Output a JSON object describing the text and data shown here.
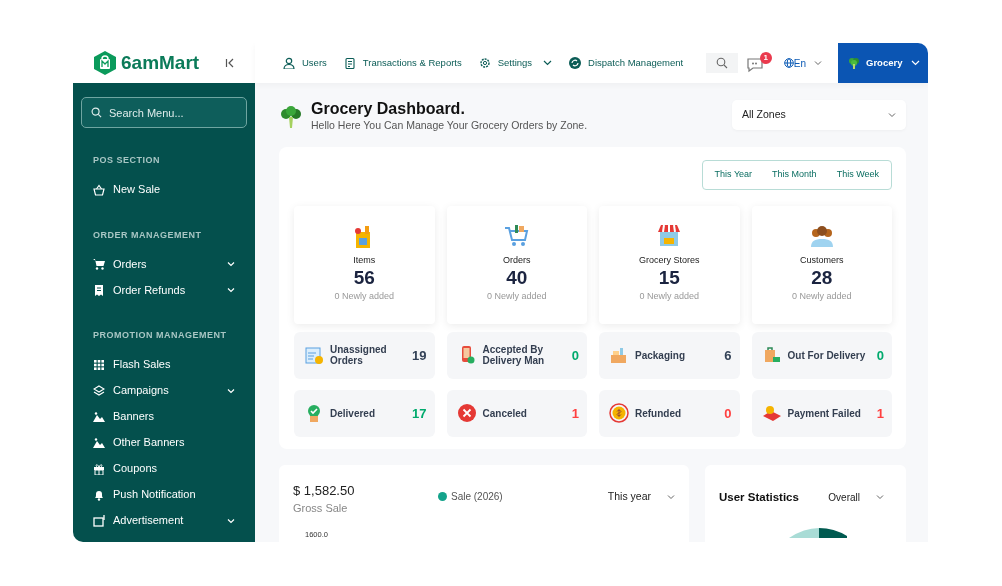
{
  "brand": {
    "name": "6amMart"
  },
  "topnav": [
    {
      "label": "Users",
      "dropdown": false
    },
    {
      "label": "Transactions & Reports",
      "dropdown": false
    },
    {
      "label": "Settings",
      "dropdown": true
    },
    {
      "label": "Dispatch Management",
      "dropdown": false
    }
  ],
  "notifications": {
    "count": "1"
  },
  "language": {
    "label": "En"
  },
  "module": {
    "label": "Grocery"
  },
  "sidebar": {
    "search": {
      "placeholder": "Search Menu..."
    },
    "sections": [
      {
        "title": "POS SECTION",
        "items": [
          {
            "label": "New Sale",
            "expandable": false
          }
        ]
      },
      {
        "title": "ORDER MANAGEMENT",
        "items": [
          {
            "label": "Orders",
            "expandable": true
          },
          {
            "label": "Order Refunds",
            "expandable": true
          }
        ]
      },
      {
        "title": "PROMOTION MANAGEMENT",
        "items": [
          {
            "label": "Flash Sales",
            "expandable": false
          },
          {
            "label": "Campaigns",
            "expandable": true
          },
          {
            "label": "Banners",
            "expandable": false
          },
          {
            "label": "Other Banners",
            "expandable": false
          },
          {
            "label": "Coupons",
            "expandable": false
          },
          {
            "label": "Push Notification",
            "expandable": false
          },
          {
            "label": "Advertisement",
            "expandable": true
          }
        ]
      }
    ]
  },
  "header": {
    "title": "Grocery Dashboard.",
    "subtitle": "Hello Here You Can Manage Your Grocery Orders by Zone.",
    "zone": "All Zones"
  },
  "period_tabs": [
    {
      "label": "This Year",
      "selected": false
    },
    {
      "label": "This Month",
      "selected": false
    },
    {
      "label": "This Week",
      "selected": false
    }
  ],
  "summary": [
    {
      "label": "Items",
      "value": "56",
      "note": "0 Newly added"
    },
    {
      "label": "Orders",
      "value": "40",
      "note": "0 Newly added"
    },
    {
      "label": "Grocery Stores",
      "value": "15",
      "note": "0 Newly added"
    },
    {
      "label": "Customers",
      "value": "28",
      "note": "0 Newly added"
    }
  ],
  "statuses": [
    {
      "label": "Unassigned Orders",
      "count": "19",
      "color": "#334257"
    },
    {
      "label": "Accepted By Delivery Man",
      "count": "0",
      "color": "#00aa6d"
    },
    {
      "label": "Packaging",
      "count": "6",
      "color": "#334257"
    },
    {
      "label": "Out For Delivery",
      "count": "0",
      "color": "#00aa6d"
    },
    {
      "label": "Delivered",
      "count": "17",
      "color": "#00aa6d"
    },
    {
      "label": "Canceled",
      "count": "1",
      "color": "#ff4040"
    },
    {
      "label": "Refunded",
      "count": "0",
      "color": "#ff4040"
    },
    {
      "label": "Payment Failed",
      "count": "1",
      "color": "#ff4040"
    }
  ],
  "sales": {
    "amount": "$ 1,582.50",
    "caption": "Gross Sale",
    "legend": {
      "label": "Sale (2026)",
      "color": "#14a38b"
    },
    "period": "This year",
    "axis_label": "1600.0"
  },
  "user_statistics": {
    "title": "User Statistics",
    "period": "Overall"
  }
}
